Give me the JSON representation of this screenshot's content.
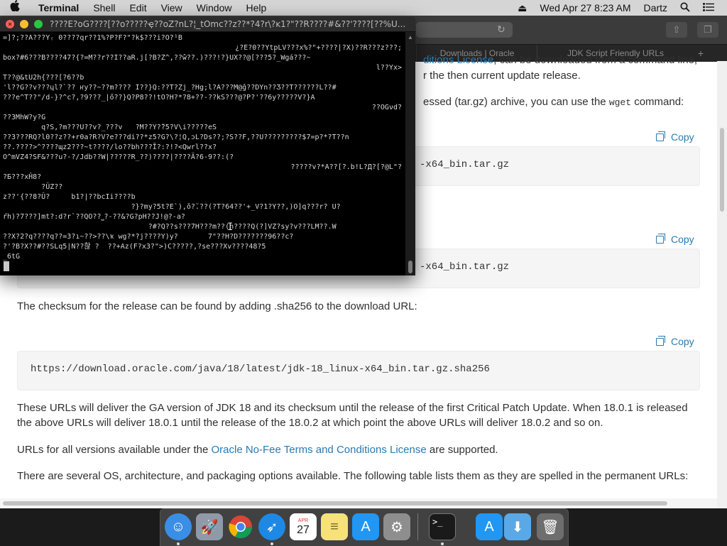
{
  "menubar": {
    "apple_icon": "apple-icon",
    "app_name": "Terminal",
    "menus": [
      "Shell",
      "Edit",
      "View",
      "Window",
      "Help"
    ],
    "clock": "Wed Apr 27  8:23 AM",
    "user": "Dartz",
    "icons": [
      "eject-icon",
      "search-icon",
      "list-icon"
    ]
  },
  "terminal": {
    "title": "????E?oG????[??o?????ҿ??oZ?nL?¦_tOmc??z??*?4?r\\?ĸ1?\"??R????#&??'????[??%U...",
    "lines": [
      {
        "text": "=]?;??A???Y₍ 0????qr??1%?P?F?\"?k$???i?O?¹B",
        "align": "left"
      },
      {
        "text": "¿?E?0??Ytp̧LV???x%?\"+????|?X)??R???z???;",
        "align": "right"
      },
      {
        "text": "box?#6???B????47?{?=M??r??I??aR.j[?B?Z^,??ŵ??.)???!?}UX??@[???5?_Wgá???~",
        "align": "left"
      },
      {
        "text": "l??Yx>",
        "align": "right"
      },
      {
        "text": "T??@&tU2h{???[?6??b",
        "align": "left"
      },
      {
        "text": "'l??G??v???ɥl?`?? ҥу??~??m???? I??}Q:??T?Zj_?Hg;l?A???M@ǧ??DYn??Ʒ??T??????L??#",
        "align": "left"
      },
      {
        "text": "???e^T??\"/d-}?^c?,?9???_|ő??}Q?P8??!tO?H?*?8+??-??kS???@?P?'??6y?????V?}A",
        "align": "left"
      },
      {
        "text": "??OGνd?",
        "align": "right"
      },
      {
        "text": "??3MhW?y?G",
        "align": "left"
      },
      {
        "text": "         q?S,?m???U??v?_???v   ?M??Y?̃?5?V\\i?????eS",
        "align": "left"
      },
      {
        "text": "??3???RQ?l0??z??+r0a?R?V?e???di??*z5?G?\\?¦Q,ɔL?Ds??;?S??F,??U?????????$7=p?*?T??n",
        "align": "left"
      },
      {
        "text": "??.????>^????ɰz2???~t????/lo??bh???Ĭ?:?!?<Qwrl??x?",
        "align": "left"
      },
      {
        "text": "O^mVZ4?SF&???u?-?/Jdb??W|?????R_??)????|????Ä?6-9??:(?",
        "align": "left"
      },
      {
        "text": "?????v?*A??[?.b!L?Д?[?@L\"?",
        "align": "right"
      },
      {
        "text": "?Б???xĤ8?",
        "align": "left"
      },
      {
        "text": "         ?ÛZ??",
        "align": "left"
      },
      {
        "text": "z??'{??8?Û?     b1?|??bcIi????b",
        "align": "left"
      },
      {
        "text": "                              ?}?my?5t?E`),ǒ?̃.??(?T?64??'+_V?1?Y??,)O]q???r? U?",
        "align": "left"
      },
      {
        "text": "ŕh)?7???]mt?:d?r`??QO??⎵?-??&?G?pH??J!@?-a?",
        "align": "left"
      },
      {
        "text": "                                  ?#?Q??s???7H???m??(n????Q(?]VZ?sy?v???LM??.W",
        "align": "left"
      },
      {
        "text": "??X?2?q????q??=3?ı~??>??\\ҡ wg?*?j????Y)y?       7\"??H?D???????96??c?",
        "align": "left"
      },
      {
        "text": "?'?B?X??#??SLq5|N??핞 ?  ??+Az(F?x3?\">)C?????,?se???Xv????48?5",
        "align": "left"
      },
      {
        "text": "_6tG",
        "align": "left"
      }
    ]
  },
  "browser": {
    "tabs": [
      "Downloads | Oracle",
      "JDK Script Friendly URLs"
    ],
    "partial_top": [
      {
        "before": "",
        "link": "ditions License",
        "after": ", can be downloaded from a command line,"
      },
      {
        "before": "r the then current update release.",
        "link": "",
        "after": ""
      }
    ],
    "wget_para": {
      "before": "essed (tar.gz) archive, you can use the ",
      "code": "wget",
      "after": " command:"
    },
    "copy_label": "Copy",
    "code_blocks": [
      "-x64_bin.tar.gz",
      "-x64_bin.tar.gz",
      "https://download.oracle.com/java/18/latest/jdk-18_linux-x64_bin.tar.gz.sha256"
    ],
    "checksum_para": "The checksum for the release can be found by adding .sha256 to the download URL:",
    "ga_para": "These URLs will deliver the GA version of JDK 18 and its checksum until the release of the first Critical Patch Update. When 18.0.1 is released the above URLs will deliver 18.0.1 until the release of the 18.0.2 at which point the above URLs will deliver 18.0.2 and so on.",
    "urls_para": {
      "before": "URLs for all versions available under the ",
      "link": "Oracle No-Fee Terms and Conditions License",
      "after": " are supported."
    },
    "os_para": "There are several OS, architecture, and packaging options available. The following table lists them as they are spelled in the permanent URLs:"
  },
  "dock": {
    "apps": [
      {
        "name": "finder-icon",
        "color": "#3a8ee6",
        "glyph": "☺"
      },
      {
        "name": "launchpad-icon",
        "color": "#8f9aa8",
        "glyph": "🚀"
      },
      {
        "name": "chrome-icon",
        "color": "#e8e8e8",
        "glyph": "◉"
      },
      {
        "name": "safari-icon",
        "color": "#1e88e5",
        "glyph": "➶"
      },
      {
        "name": "calendar-icon",
        "color": "#ffffff",
        "glyph": "27",
        "sub": "APR"
      },
      {
        "name": "notes-icon",
        "color": "#f7e27a",
        "glyph": "≡"
      },
      {
        "name": "app-store-icon",
        "color": "#2196f3",
        "glyph": "A"
      },
      {
        "name": "system-preferences-icon",
        "color": "#8e8e8e",
        "glyph": "⚙"
      },
      {
        "name": "terminal-icon",
        "color": "#1a1a1a",
        "glyph": ">_"
      },
      {
        "name": "app-store-2-icon",
        "color": "#2196f3",
        "glyph": "A"
      },
      {
        "name": "downloads-folder-icon",
        "color": "#5aa9e6",
        "glyph": "⬇"
      },
      {
        "name": "trash-icon",
        "color": "#6e6e6e",
        "glyph": "🗑"
      }
    ],
    "calendar": {
      "month": "APR",
      "day": "27"
    }
  }
}
